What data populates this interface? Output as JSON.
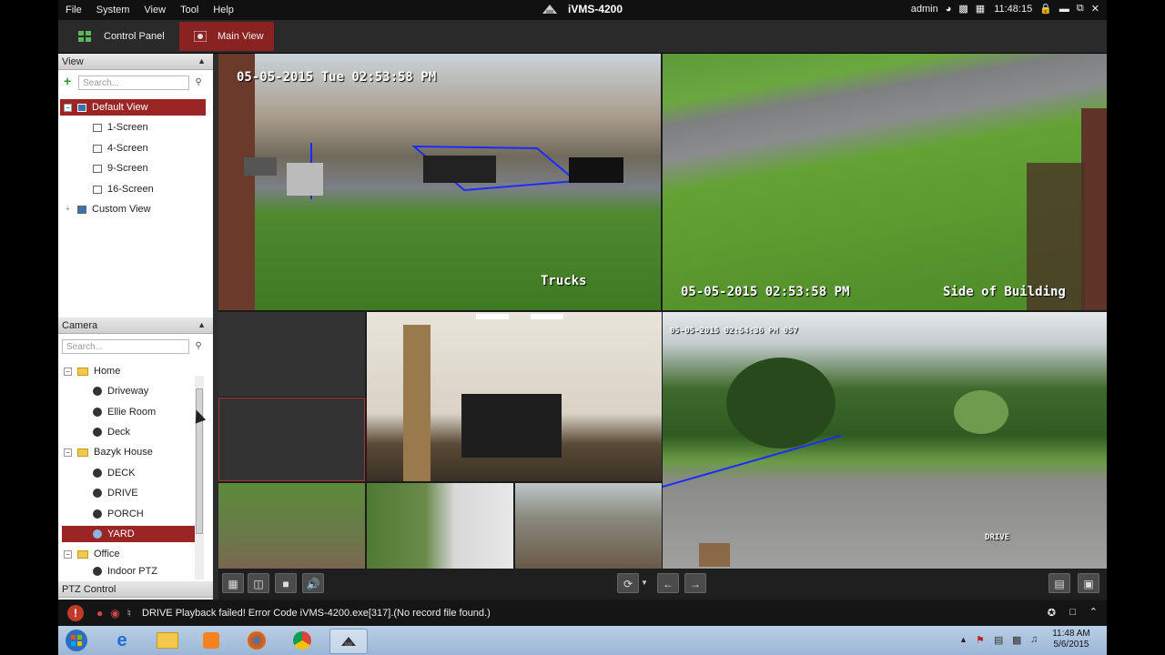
{
  "menu": [
    "File",
    "System",
    "View",
    "Tool",
    "Help"
  ],
  "app_title": "iVMS-4200",
  "user": "admin",
  "clock": "11:48:15",
  "tabs": [
    {
      "label": "Control Panel"
    },
    {
      "label": "Main View"
    }
  ],
  "view_panel": {
    "header": "View",
    "search_placeholder": "Search...",
    "items": [
      "Default View",
      "1-Screen",
      "4-Screen",
      "9-Screen",
      "16-Screen",
      "Custom View"
    ]
  },
  "camera_panel": {
    "header": "Camera",
    "search_placeholder": "Search...",
    "groups": [
      {
        "name": "Home",
        "cameras": [
          "Driveway",
          "Ellie Room",
          "Deck"
        ]
      },
      {
        "name": "Bazyk House",
        "cameras": [
          "DECK",
          "DRIVE",
          "PORCH",
          "YARD"
        ]
      },
      {
        "name": "Office",
        "cameras": [
          "Indoor PTZ"
        ]
      }
    ],
    "selected": "YARD"
  },
  "ptz_header": "PTZ Control",
  "video": {
    "cam1_time": "05-05-2015 Tue 02:53:58 PM",
    "cam1_label": "Trucks",
    "cam2_time": "05-05-2015 02:53:58 PM",
    "cam2_label": "Side of Building",
    "cam3_time": "05-05-2015 02:54:36 PM 057",
    "cam3_label": "DRIVE"
  },
  "status_message": "DRIVE Playback failed! Error Code iVMS-4200.exe[317].(No record file found.)",
  "taskbar": {
    "time": "11:48 AM",
    "date": "5/6/2015"
  },
  "colors": {
    "accent": "#9b2525",
    "frame": "#1b1b1b",
    "taskbar": "#a9c2de"
  }
}
